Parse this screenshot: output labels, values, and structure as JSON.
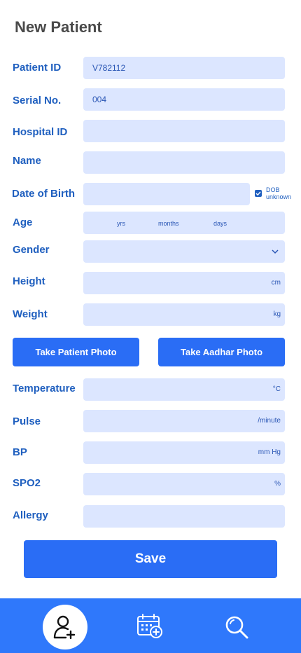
{
  "page": {
    "title": "New Patient"
  },
  "form": {
    "patient_id": {
      "label": "Patient ID",
      "value": "V782112"
    },
    "serial_no": {
      "label": "Serial No.",
      "value": "004"
    },
    "hospital_id": {
      "label": "Hospital ID",
      "value": ""
    },
    "name": {
      "label": "Name",
      "value": ""
    },
    "dob": {
      "label": "Date of Birth",
      "value": "",
      "unknown_line1": "DOB",
      "unknown_line2": "unknown",
      "unknown_checked": true
    },
    "age": {
      "label": "Age",
      "years": "yrs",
      "months": "months",
      "days": "days"
    },
    "gender": {
      "label": "Gender",
      "value": ""
    },
    "height": {
      "label": "Height",
      "unit": "cm"
    },
    "weight": {
      "label": "Weight",
      "unit": "kg"
    },
    "temperature": {
      "label": "Temperature",
      "unit": "°C"
    },
    "pulse": {
      "label": "Pulse",
      "unit": "/minute"
    },
    "bp": {
      "label": "BP",
      "unit": "mm Hg"
    },
    "spo2": {
      "label": "SPO2",
      "unit": "%"
    },
    "allergy": {
      "label": "Allergy",
      "value": ""
    }
  },
  "buttons": {
    "patient_photo": "Take Patient Photo",
    "aadhar_photo": "Take Aadhar Photo",
    "save": "Save"
  },
  "nav": {
    "items": [
      {
        "icon": "add-patient-icon",
        "active": true
      },
      {
        "icon": "add-appointment-icon",
        "active": false
      },
      {
        "icon": "search-icon",
        "active": false
      }
    ]
  },
  "colors": {
    "primary": "#2a6df5",
    "label": "#1f5fbf",
    "field_bg": "#dce6ff",
    "title": "#4a4a4a"
  }
}
